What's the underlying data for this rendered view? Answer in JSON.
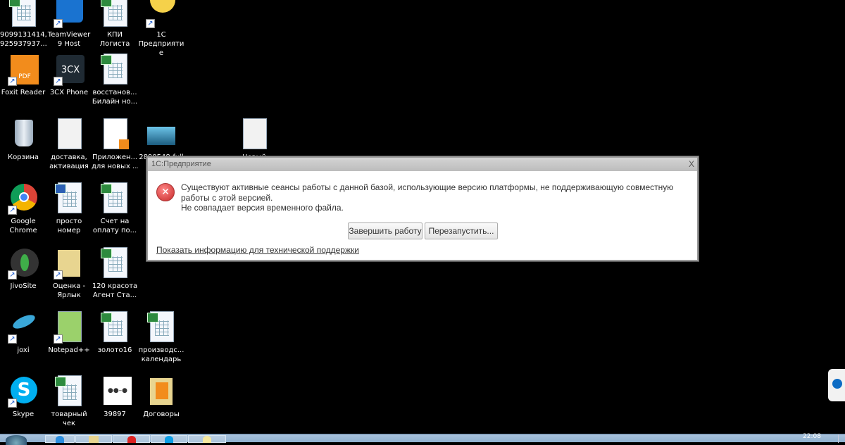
{
  "desktop": {
    "icons": [
      {
        "type": "xls",
        "lines": [
          "9099131414,",
          "925937937..."
        ],
        "shortcut": false
      },
      {
        "type": "teamviewer",
        "lines": [
          "TeamViewer",
          "9 Host"
        ],
        "shortcut": true
      },
      {
        "type": "xls",
        "lines": [
          "КПИ",
          "Логиста"
        ],
        "shortcut": false
      },
      {
        "type": "onec",
        "lines": [
          "1С",
          "Предприяти",
          "е"
        ],
        "shortcut": true
      },
      {
        "type": "foxit",
        "lines": [
          "Foxit Reader"
        ],
        "shortcut": true
      },
      {
        "type": "3cx",
        "lines": [
          "3CX Phone"
        ],
        "shortcut": true
      },
      {
        "type": "xls",
        "lines": [
          "восстанов...",
          "Билайн но..."
        ],
        "shortcut": false
      },
      {
        "type": "recycle",
        "lines": [
          "Корзина"
        ],
        "shortcut": false
      },
      {
        "type": "txt",
        "lines": [
          "доставка,",
          "активация"
        ],
        "shortcut": false
      },
      {
        "type": "pdfdoc",
        "lines": [
          "Приложен...",
          "для новых ..."
        ],
        "shortcut": false
      },
      {
        "type": "image",
        "lines": [
          "2890548-full"
        ],
        "shortcut": false
      },
      {
        "type": "txt",
        "lines": [
          "Новый"
        ],
        "shortcut": false
      },
      {
        "type": "chrome",
        "lines": [
          "Google",
          "Chrome"
        ],
        "shortcut": true
      },
      {
        "type": "word",
        "lines": [
          "просто",
          "номер"
        ],
        "shortcut": false
      },
      {
        "type": "xls",
        "lines": [
          "Счет на",
          "оплату  по..."
        ],
        "shortcut": false
      },
      {
        "type": "jivo",
        "lines": [
          "JivoSite"
        ],
        "shortcut": true
      },
      {
        "type": "folder",
        "lines": [
          "Оценка -",
          "Ярлык"
        ],
        "shortcut": true
      },
      {
        "type": "xls",
        "lines": [
          "120 красота",
          "Агент Ста..."
        ],
        "shortcut": false
      },
      {
        "type": "joxi",
        "lines": [
          "joxi"
        ],
        "shortcut": true
      },
      {
        "type": "notepad",
        "lines": [
          "Notepad++"
        ],
        "shortcut": true
      },
      {
        "type": "xls",
        "lines": [
          "золото16"
        ],
        "shortcut": false
      },
      {
        "type": "xls",
        "lines": [
          "производс...",
          "календарь"
        ],
        "shortcut": false
      },
      {
        "type": "skype",
        "lines": [
          "Skype"
        ],
        "shortcut": true
      },
      {
        "type": "xls",
        "lines": [
          "товарный",
          "чек"
        ],
        "shortcut": false
      },
      {
        "type": "image2",
        "lines": [
          "39897"
        ],
        "shortcut": false
      },
      {
        "type": "pdffolder",
        "lines": [
          "Договоры"
        ],
        "shortcut": false
      }
    ]
  },
  "dialog": {
    "title": "1С:Предприятие",
    "close": "X",
    "icon": "error-icon",
    "message_line1": "Существуют активные сеансы работы с данной базой, использующие версию платформы, не поддерживающую совместную работы с этой версией.",
    "message_line2": "Не совпадает версия временного файла.",
    "buttons": {
      "finish": "Завершить работу",
      "restart": "Перезапустить..."
    },
    "support_link": "Показать информацию для технической поддержки"
  },
  "taskbar": {
    "clock": "22:08",
    "items": [
      "ie",
      "explorer",
      "opera",
      "skype",
      "1c"
    ]
  },
  "colors": {
    "error": "#c62828",
    "taskbar": "#a9c3dc"
  }
}
